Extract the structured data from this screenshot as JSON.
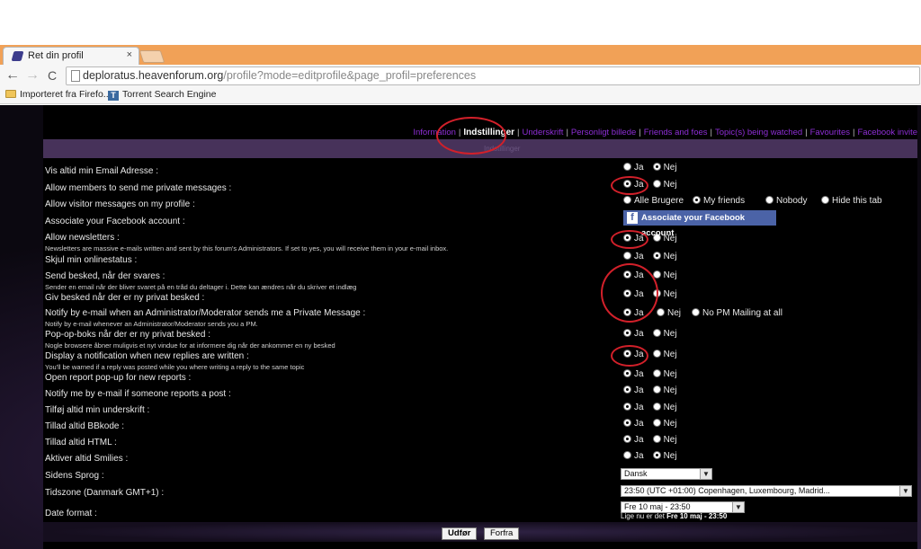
{
  "browser": {
    "tab_title": "Ret din profil",
    "tab_close": "×",
    "back": "←",
    "forward": "→",
    "reload": "C",
    "url_host": "deploratus.heavenforum.org",
    "url_rest": "/profile?mode=editprofile&page_profil=preferences",
    "bookmarks": [
      "Importeret fra Firefo...",
      "Torrent Search Engine"
    ],
    "bookmark_icons": [
      "folder-icon",
      "te-icon"
    ]
  },
  "nav": {
    "links": [
      "Information",
      "Indstillinger",
      "Underskrift",
      "Personligt billede",
      "Friends and foes",
      "Topic(s) being watched",
      "Favourites",
      "Facebook invite"
    ],
    "active_index": 1,
    "separator": "|",
    "header_text": "Indstillinger"
  },
  "settings": [
    {
      "label": "Vis altid min Email Adresse :",
      "hint": "",
      "options": [
        "Ja",
        "Nej"
      ],
      "selected": 1
    },
    {
      "label": "Allow members to send me private messages :",
      "hint": "",
      "options": [
        "Ja",
        "Nej"
      ],
      "selected": 0
    },
    {
      "label": "Allow visitor messages on my profile :",
      "hint": "",
      "options": [
        "Alle Brugere",
        "My friends",
        "Nobody",
        "Hide this tab"
      ],
      "selected": 1
    },
    {
      "label": "Associate your Facebook account :",
      "hint": "",
      "button": "Associate your Facebook account"
    },
    {
      "label": "Allow newsletters :",
      "hint": "Newsletters are massive e-mails written and sent by this forum's Administrators. If set to yes, you will receive them in your e-mail inbox.",
      "options": [
        "Ja",
        "Nej"
      ],
      "selected": 0
    },
    {
      "label": "Skjul min onlinestatus :",
      "hint": "",
      "options": [
        "Ja",
        "Nej"
      ],
      "selected": 1
    },
    {
      "label": "Send besked, når der svares :",
      "hint": "Sender en email når der bliver svaret på en tråd du deltager i. Dette kan ændres når du skriver et indlæg",
      "options": [
        "Ja",
        "Nej"
      ],
      "selected": 0
    },
    {
      "label": "Giv besked når der er ny privat besked :",
      "hint": "",
      "options": [
        "Ja",
        "Nej"
      ],
      "selected": 0
    },
    {
      "label": "Notify by e-mail when an Administrator/Moderator sends me a Private Message :",
      "hint": "Notify by e-mail whenever an Administrator/Moderator sends you a PM.",
      "options": [
        "Ja",
        "Nej",
        "No PM Mailing at all"
      ],
      "selected": 0
    },
    {
      "label": "Pop-op-boks når der er ny privat besked :",
      "hint": "Nogle browsere åbner muligvis et nyt vindue for at informere dig når der ankommer en ny besked",
      "options": [
        "Ja",
        "Nej"
      ],
      "selected": 0
    },
    {
      "label": "Display a notification when new replies are written :",
      "hint": "You'll be warned if a reply was posted while you where writing a reply to the same topic",
      "options": [
        "Ja",
        "Nej"
      ],
      "selected": 0
    },
    {
      "label": "Open report pop-up for new reports :",
      "hint": "",
      "options": [
        "Ja",
        "Nej"
      ],
      "selected": 0
    },
    {
      "label": "Notify me by e-mail if someone reports a post :",
      "hint": "",
      "options": [
        "Ja",
        "Nej"
      ],
      "selected": 0
    },
    {
      "label": "Tilføj altid min underskrift :",
      "hint": "",
      "options": [
        "Ja",
        "Nej"
      ],
      "selected": 0
    },
    {
      "label": "Tillad altid BBkode :",
      "hint": "",
      "options": [
        "Ja",
        "Nej"
      ],
      "selected": 0
    },
    {
      "label": "Tillad altid HTML :",
      "hint": "",
      "options": [
        "Ja",
        "Nej"
      ],
      "selected": 0
    },
    {
      "label": "Aktiver altid Smilies :",
      "hint": "",
      "options": [
        "Ja",
        "Nej"
      ],
      "selected": 1
    },
    {
      "label": "Sidens Sprog :",
      "hint": "",
      "select": "Dansk"
    },
    {
      "label": "Tidszone (Danmark GMT+1) :",
      "hint": "",
      "select": "23:50 (UTC +01:00) Copenhagen, Luxembourg, Madrid..."
    },
    {
      "label": "Date format :",
      "hint": "",
      "select": "Fre 10 maj - 23:50"
    }
  ],
  "now_line": {
    "prefix": "Lige nu er det ",
    "value": "Fre 10 maj - 23:50"
  },
  "buttons": {
    "submit": "Udfør",
    "reset": "Forfra"
  },
  "colors": {
    "accent_link": "#8e2ed6",
    "header_bar": "#47325a",
    "annotation_ring": "#d2202a",
    "facebook": "#4b63a7"
  }
}
